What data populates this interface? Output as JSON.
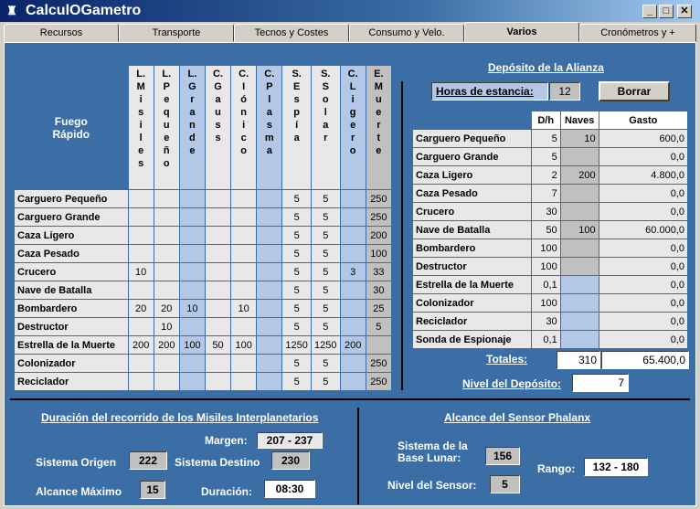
{
  "window": {
    "title": "CalculOGametro"
  },
  "tabs": [
    "Recursos",
    "Transporte",
    "Tecnos y Costes",
    "Consumo y Velo.",
    "Varios",
    "Cronómetros y +"
  ],
  "fuego": {
    "title_line1": "Fuego",
    "title_line2": "Rápido",
    "columns": [
      {
        "a": "L.",
        "b": "Misiles"
      },
      {
        "a": "L.",
        "b": "Pequeño"
      },
      {
        "a": "L.",
        "b": "Grande"
      },
      {
        "a": "C.",
        "b": "Gauss"
      },
      {
        "a": "C.",
        "b": "Iónico"
      },
      {
        "a": "C.",
        "b": "Plasma"
      },
      {
        "a": "S.",
        "b": "Espía"
      },
      {
        "a": "S.",
        "b": "Solar"
      },
      {
        "a": "C.",
        "b": "Ligero"
      },
      {
        "a": "E.",
        "b": "Muerte"
      }
    ],
    "rows": [
      {
        "name": "Carguero Pequeño",
        "v": [
          "",
          "",
          "",
          "",
          "",
          "",
          "5",
          "5",
          "",
          "250"
        ]
      },
      {
        "name": "Carguero Grande",
        "v": [
          "",
          "",
          "",
          "",
          "",
          "",
          "5",
          "5",
          "",
          "250"
        ]
      },
      {
        "name": "Caza  Ligero",
        "v": [
          "",
          "",
          "",
          "",
          "",
          "",
          "5",
          "5",
          "",
          "200"
        ]
      },
      {
        "name": "Caza  Pesado",
        "v": [
          "",
          "",
          "",
          "",
          "",
          "",
          "5",
          "5",
          "",
          "100"
        ]
      },
      {
        "name": "Crucero",
        "v": [
          "10",
          "",
          "",
          "",
          "",
          "",
          "5",
          "5",
          "3",
          "33"
        ]
      },
      {
        "name": "Nave de Batalla",
        "v": [
          "",
          "",
          "",
          "",
          "",
          "",
          "5",
          "5",
          "",
          "30"
        ]
      },
      {
        "name": "Bombardero",
        "v": [
          "20",
          "20",
          "10",
          "",
          "10",
          "",
          "5",
          "5",
          "",
          "25"
        ]
      },
      {
        "name": "Destructor",
        "v": [
          "",
          "10",
          "",
          "",
          "",
          "",
          "5",
          "5",
          "",
          "5"
        ]
      },
      {
        "name": "Estrella de la Muerte",
        "v": [
          "200",
          "200",
          "100",
          "50",
          "100",
          "",
          "1250",
          "1250",
          "200",
          ""
        ]
      },
      {
        "name": "Colonizador",
        "v": [
          "",
          "",
          "",
          "",
          "",
          "",
          "5",
          "5",
          "",
          "250"
        ]
      },
      {
        "name": "Reciclador",
        "v": [
          "",
          "",
          "",
          "",
          "",
          "",
          "5",
          "5",
          "",
          "250"
        ]
      }
    ]
  },
  "deposito": {
    "title": "Depósito de la Alianza",
    "horas_label": "Horas de estancia:",
    "horas_value": "12",
    "borrar": "Borrar",
    "headers": [
      "D/h",
      "Naves",
      "Gasto"
    ],
    "rows": [
      {
        "name": "Carguero Pequeño",
        "dh": "5",
        "naves": "10",
        "gasto": "600,0"
      },
      {
        "name": "Carguero Grande",
        "dh": "5",
        "naves": "",
        "gasto": "0,0"
      },
      {
        "name": "Caza  Ligero",
        "dh": "2",
        "naves": "200",
        "gasto": "4.800,0"
      },
      {
        "name": "Caza  Pesado",
        "dh": "7",
        "naves": "",
        "gasto": "0,0"
      },
      {
        "name": "Crucero",
        "dh": "30",
        "naves": "",
        "gasto": "0,0"
      },
      {
        "name": "Nave de Batalla",
        "dh": "50",
        "naves": "100",
        "gasto": "60.000,0"
      },
      {
        "name": "Bombardero",
        "dh": "100",
        "naves": "",
        "gasto": "0,0"
      },
      {
        "name": "Destructor",
        "dh": "100",
        "naves": "",
        "gasto": "0,0"
      },
      {
        "name": "Estrella de la Muerte",
        "dh": "0,1",
        "naves": "",
        "gasto": "0,0"
      },
      {
        "name": "Colonizador",
        "dh": "100",
        "naves": "",
        "gasto": "0,0"
      },
      {
        "name": "Reciclador",
        "dh": "30",
        "naves": "",
        "gasto": "0,0"
      },
      {
        "name": "Sonda de Espionaje",
        "dh": "0,1",
        "naves": "",
        "gasto": "0,0"
      }
    ],
    "totales_label": "Totales:",
    "totales_naves": "310",
    "totales_gasto": "65.400,0",
    "nivel_label": "Nivel del Depósito:",
    "nivel_value": "7"
  },
  "misiles": {
    "title": "Duración del recorrido de los Misiles Interplanetarios",
    "margen_label": "Margen:",
    "margen_value": "207 - 237",
    "origen_label": "Sistema Origen",
    "origen_value": "222",
    "destino_label": "Sistema Destino",
    "destino_value": "230",
    "alcance_label": "Alcance Máximo",
    "alcance_value": "15",
    "duracion_label": "Duración:",
    "duracion_value": "08:30"
  },
  "phalanx": {
    "title": "Alcance del Sensor Phalanx",
    "base_label1": "Sistema de la",
    "base_label2": "Base Lunar:",
    "base_value": "156",
    "rango_label": "Rango:",
    "rango_value": "132 - 180",
    "nivel_label": "Nivel del Sensor:",
    "nivel_value": "5"
  }
}
